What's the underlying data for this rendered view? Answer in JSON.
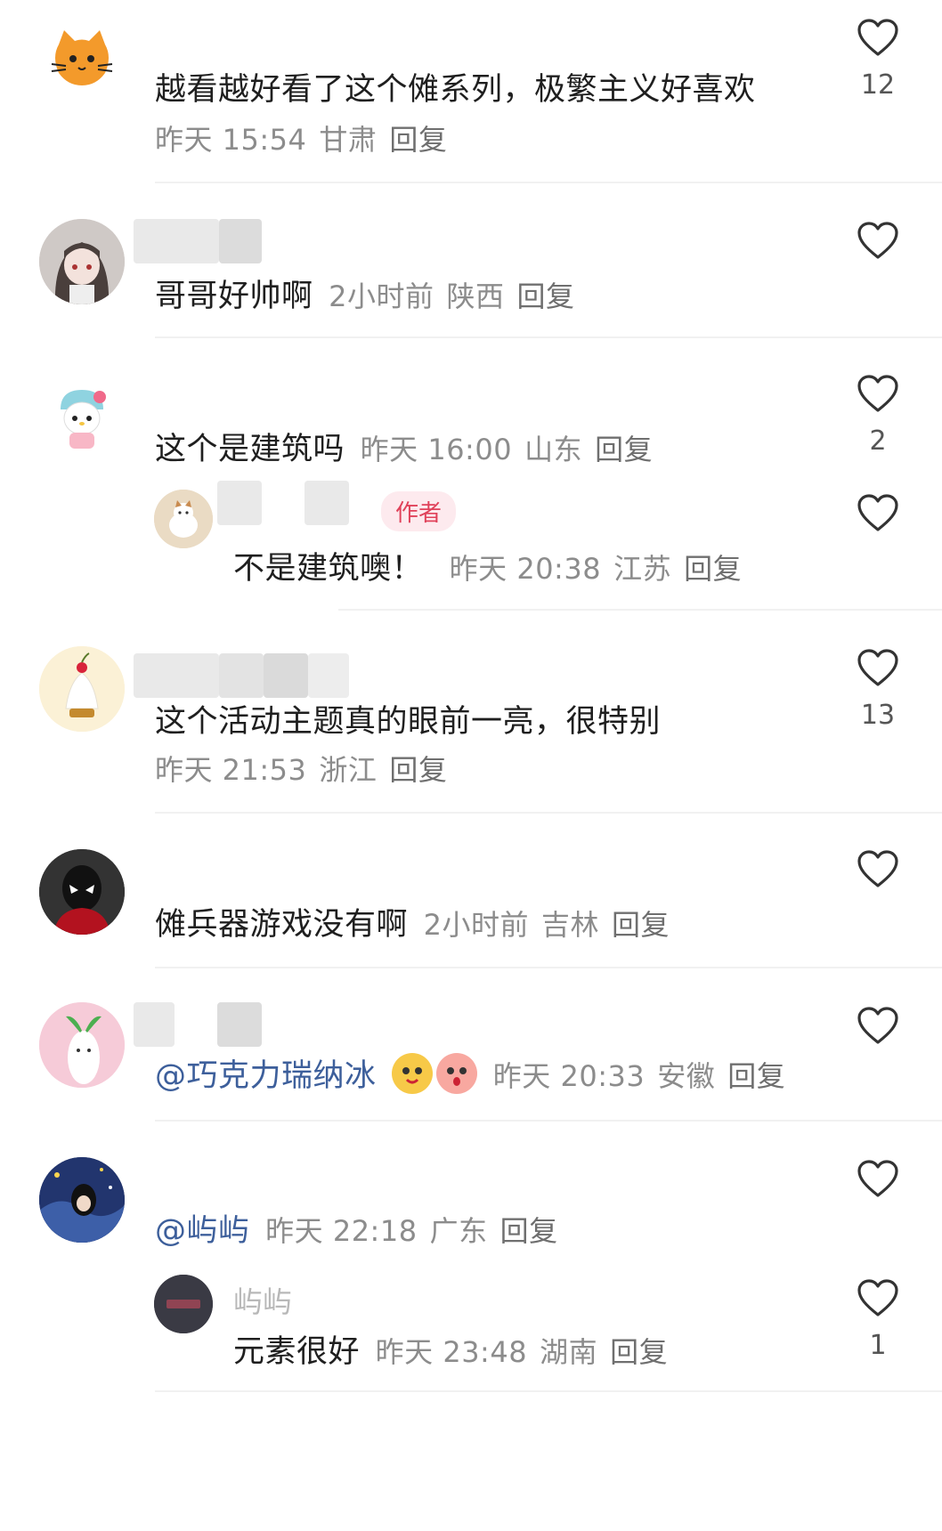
{
  "comments": [
    {
      "username": "",
      "text": "越看越好看了这个傩系列，极繁主义好喜欢",
      "time": "昨天 15:54",
      "region": "甘肃",
      "reply_label": "回复",
      "likes": "12",
      "avatar": "orange-cat"
    },
    {
      "username": "",
      "text": "哥哥好帅啊",
      "time": "2小时前",
      "region": "陕西",
      "reply_label": "回复",
      "likes": "",
      "avatar": "anime-girl"
    },
    {
      "username": "",
      "text": "这个是建筑吗",
      "time": "昨天 16:00",
      "region": "山东",
      "reply_label": "回复",
      "likes": "2",
      "avatar": "hello-kitty",
      "replies": [
        {
          "username": "",
          "badge": "作者",
          "text": "不是建筑噢！",
          "time": "昨天 20:38",
          "region": "江苏",
          "reply_label": "回复",
          "likes": "",
          "avatar": "cat-figure"
        }
      ]
    },
    {
      "username": "",
      "text": "这个活动主题真的眼前一亮，很特别",
      "time": "昨天 21:53",
      "region": "浙江",
      "reply_label": "回复",
      "likes": "13",
      "avatar": "cream-cake"
    },
    {
      "username": "",
      "text": "傩兵器游戏没有啊",
      "time": "2小时前",
      "region": "吉林",
      "reply_label": "回复",
      "likes": "",
      "avatar": "spider-man"
    },
    {
      "username": "",
      "mention": "@巧克力瑞纳冰",
      "emojis": [
        "yellow-face-emoji",
        "peach-face-emoji"
      ],
      "time": "昨天 20:33",
      "region": "安徽",
      "reply_label": "回复",
      "likes": "",
      "avatar": "radish-character"
    },
    {
      "username": "",
      "mention": "@屿屿",
      "time": "昨天 22:18",
      "region": "广东",
      "reply_label": "回复",
      "likes": "",
      "avatar": "starry-night-girl",
      "replies": [
        {
          "username": "屿屿",
          "text": "元素很好",
          "time": "昨天 23:48",
          "region": "湖南",
          "reply_label": "回复",
          "likes": "1",
          "avatar": "dark-logo"
        }
      ]
    }
  ],
  "colors": {
    "text": "#1f1f1f",
    "meta": "#8c8c8c",
    "mention": "#3d5f9b",
    "author_badge": "#e0425a",
    "heart_stroke": "#333333"
  },
  "icons": {
    "like": "heart-outline-icon"
  }
}
